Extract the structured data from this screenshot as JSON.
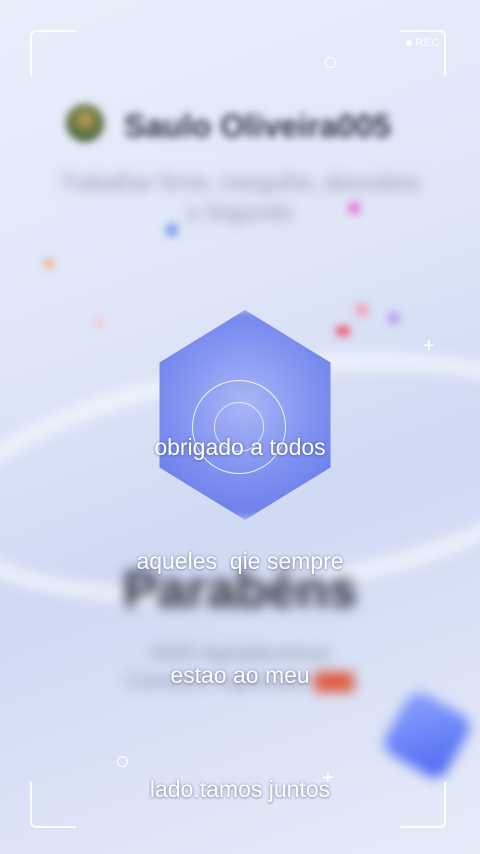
{
  "recording": {
    "label": "REC"
  },
  "background": {
    "name": "Saulo Oliveira005",
    "subtitle_line1": "Trabalhar firme, mergulhe, descobriu",
    "subtitle_line2": "o Segundo",
    "title": "Parabéns",
    "sub2_line1": "2025 Agradecemos",
    "sub2_line2": "Conosco registrado"
  },
  "caption": {
    "line1": "obrigado a todos",
    "line2": "aqueles  qie sempre",
    "line3": "estao ao meu",
    "line4": "lado.tamos juntos"
  },
  "colors": {
    "frame": "#ffffff",
    "hex": "#7d8ff0",
    "accent_red": "#e0573f"
  }
}
